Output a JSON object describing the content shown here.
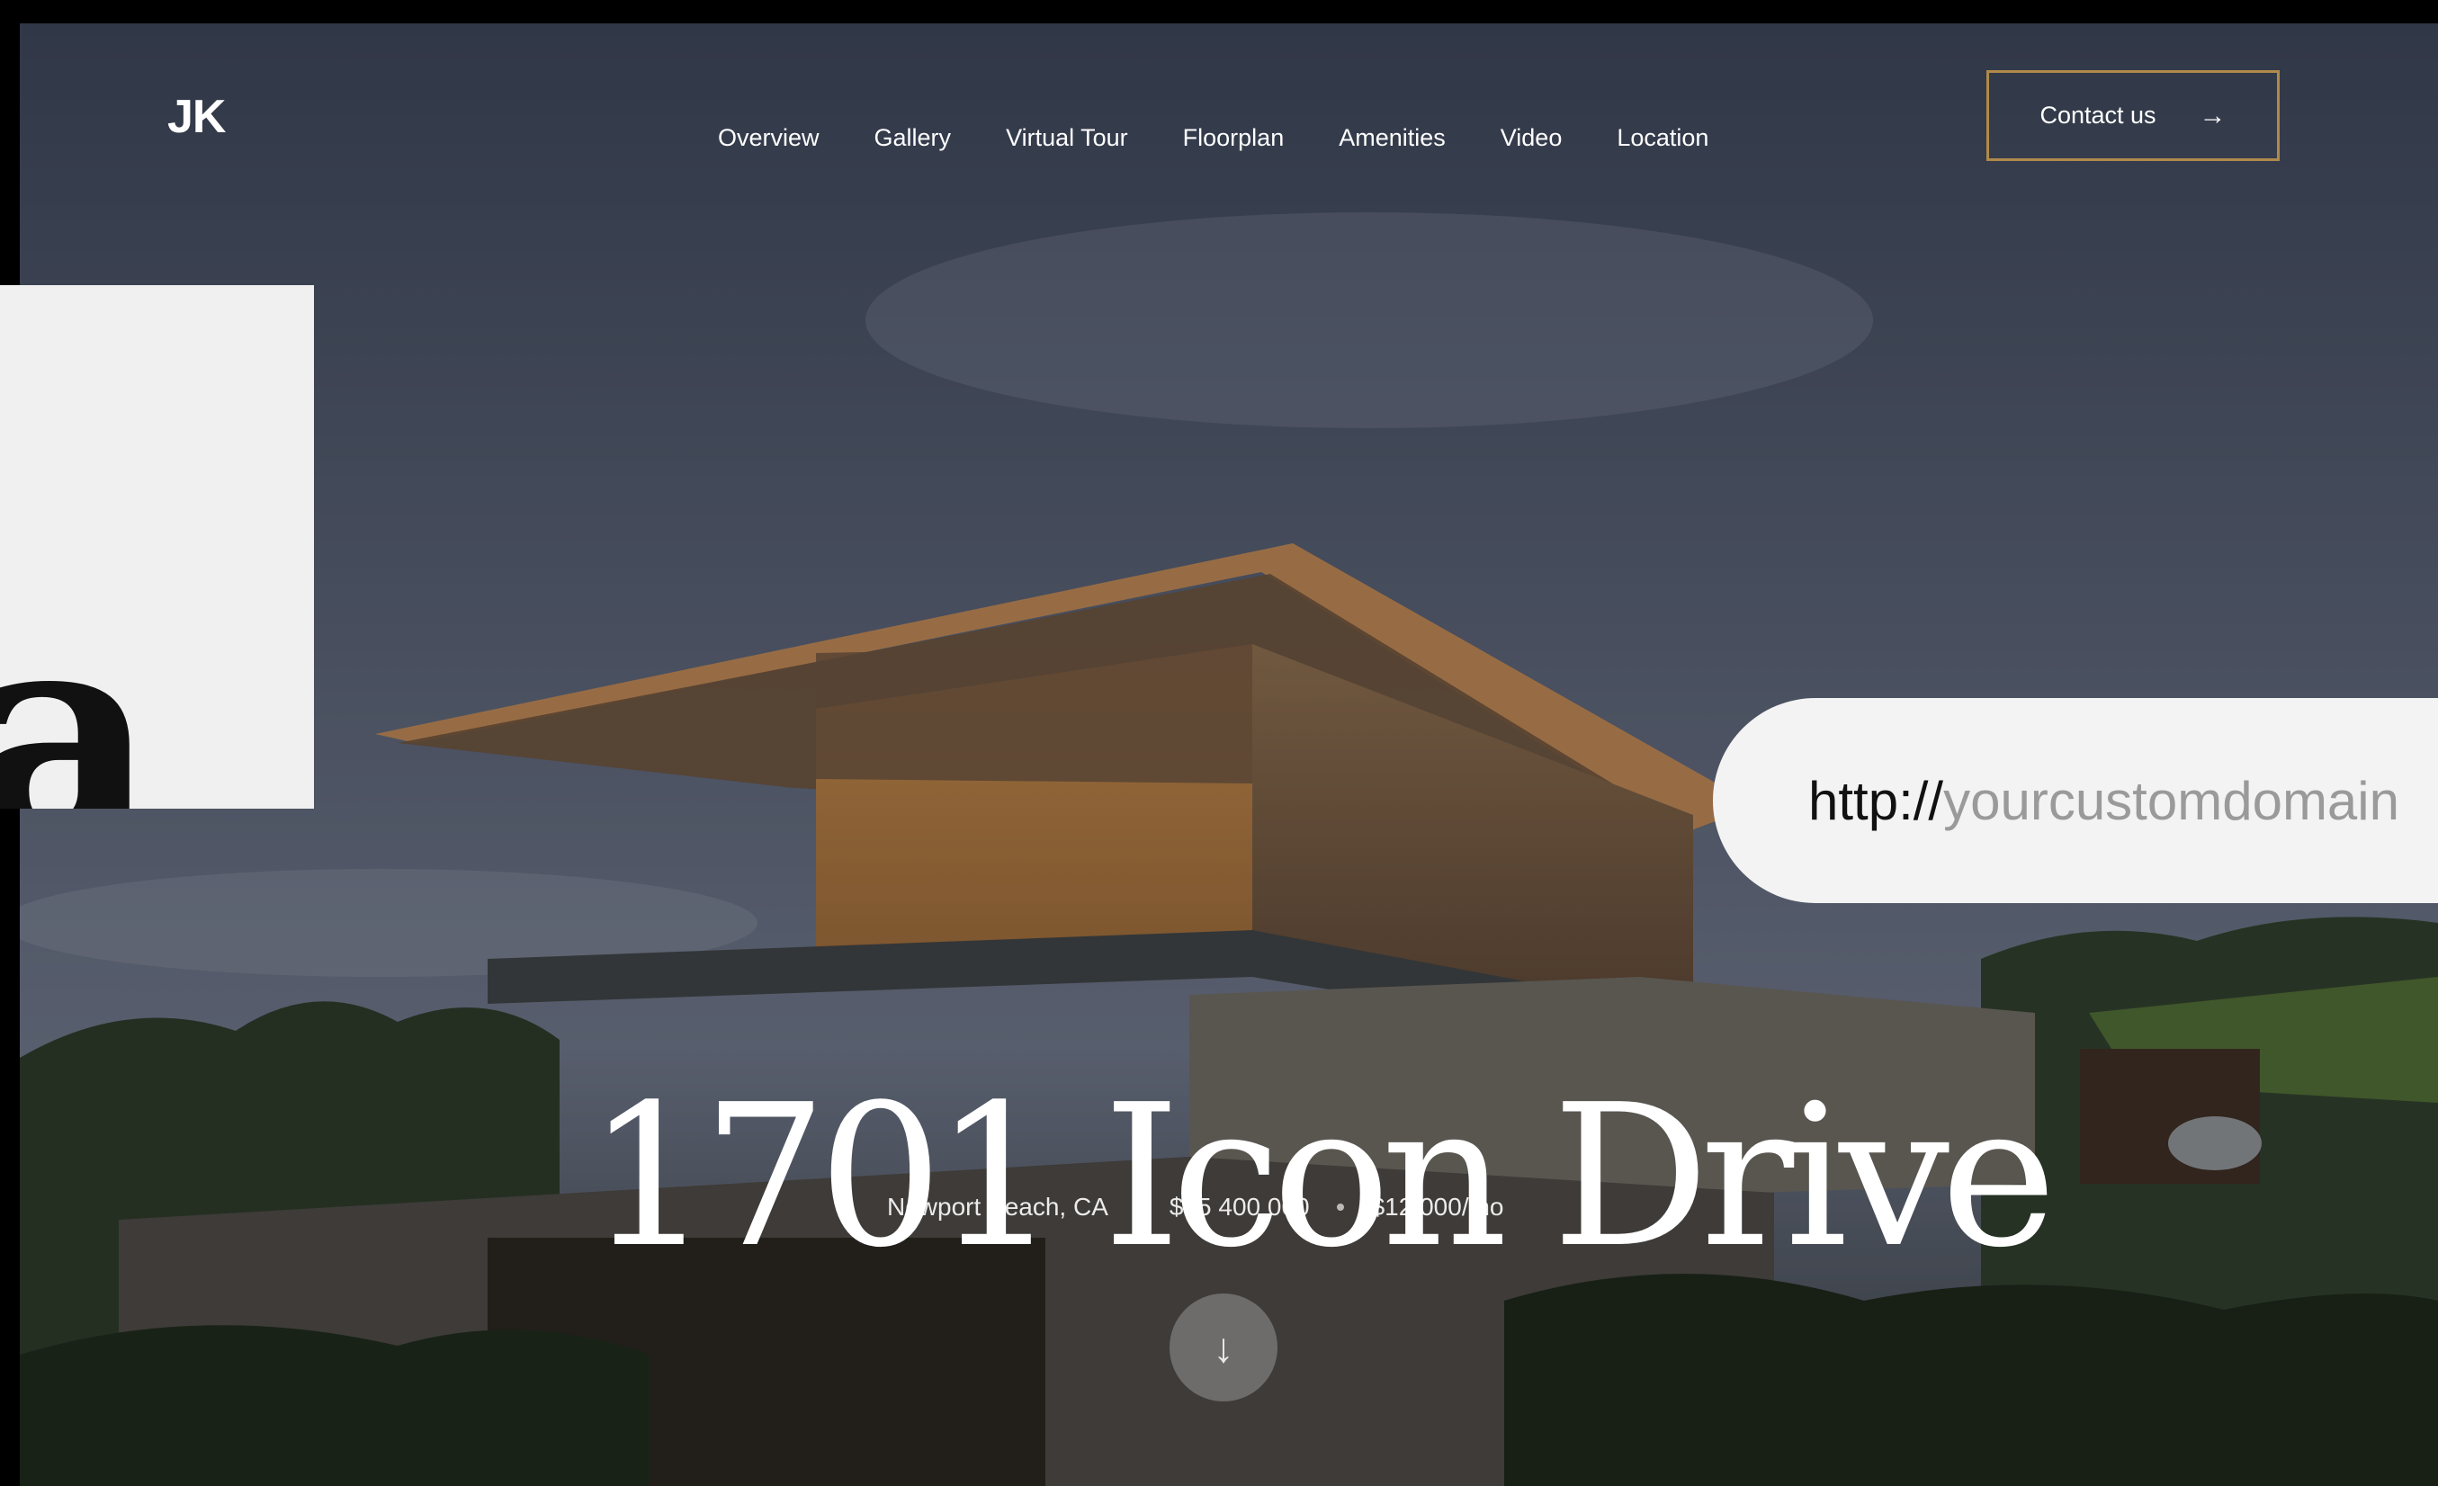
{
  "site": {
    "logo": "JK"
  },
  "nav": {
    "items": [
      {
        "label": "Overview"
      },
      {
        "label": "Gallery"
      },
      {
        "label": "Virtual Tour"
      },
      {
        "label": "Floorplan"
      },
      {
        "label": "Amenities"
      },
      {
        "label": "Video"
      },
      {
        "label": "Location"
      }
    ],
    "contact_label": "Contact us",
    "contact_icon": "arrow-right-icon"
  },
  "hero": {
    "title": "1701 Icon Drive",
    "location": "Newport Beach, CA",
    "price": "$15 400 000",
    "rent": "$12,000/mo",
    "scroll_icon": "arrow-down-icon"
  },
  "overlay": {
    "glyph": "a",
    "url_protocol": "http://",
    "url_domain": "yourcustomdomain"
  },
  "colors": {
    "accent_border": "#b08a4a",
    "sky": "#3a4254",
    "text": "#ffffff"
  }
}
